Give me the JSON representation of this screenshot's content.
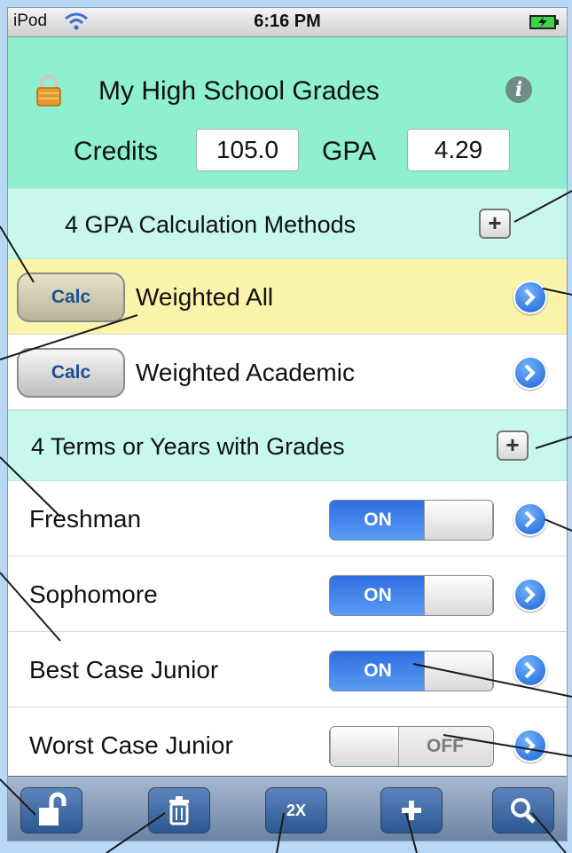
{
  "status_bar": {
    "carrier": "iPod",
    "time": "6:16 PM"
  },
  "header": {
    "title": "My High School Grades",
    "credits_label": "Credits",
    "credits_value": "105.0",
    "gpa_label": "GPA",
    "gpa_value": "4.29"
  },
  "methods_section": {
    "label": "4  GPA Calculation Methods",
    "add_label": "+",
    "items": [
      {
        "button": "Calc",
        "name": "Weighted All",
        "selected": true
      },
      {
        "button": "Calc",
        "name": "Weighted Academic",
        "selected": false
      }
    ]
  },
  "terms_section": {
    "label": "4  Terms or Years with Grades",
    "add_label": "+",
    "items": [
      {
        "name": "Freshman",
        "toggle": "ON"
      },
      {
        "name": "Sophomore",
        "toggle": "ON"
      },
      {
        "name": "Best Case Junior",
        "toggle": "ON"
      },
      {
        "name": "Worst Case Junior",
        "toggle": "OFF"
      }
    ]
  },
  "toolbar": {
    "unlock_icon": "unlock-icon",
    "trash_icon": "trash-icon",
    "double_label": "2X",
    "add_icon": "plus-icon",
    "search_icon": "search-icon"
  },
  "colors": {
    "header_bg": "#8ff0d0",
    "section_bg": "#c8f7ec",
    "selected_row": "#fbf3a9",
    "toggle_on": "#2e6de0",
    "toolbar": "#6a82a4",
    "frame": "#b9d8f6"
  }
}
